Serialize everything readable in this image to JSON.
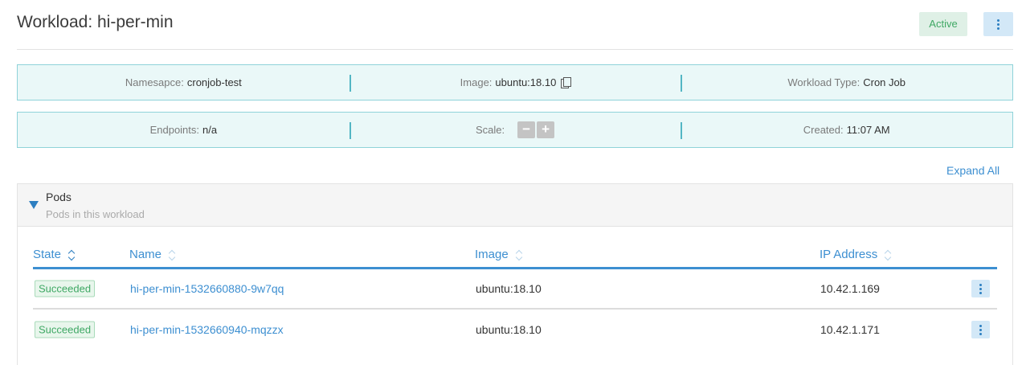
{
  "workload": {
    "title": "Workload: hi-per-min",
    "status": "Active"
  },
  "info_row1": {
    "namespace_label": "Namesapce:",
    "namespace_value": "cronjob-test",
    "image_label": "Image:",
    "image_value": "ubuntu:18.10",
    "type_label": "Workload Type:",
    "type_value": "Cron Job"
  },
  "info_row2": {
    "endpoints_label": "Endpoints:",
    "endpoints_value": "n/a",
    "scale_label": "Scale:",
    "scale_minus": "−",
    "scale_plus": "+",
    "created_label": "Created:",
    "created_value": "11:07 AM"
  },
  "expand_all": "Expand All",
  "pods": {
    "title": "Pods",
    "subtitle": "Pods in this workload",
    "columns": [
      "State",
      "Name",
      "Image",
      "IP Address"
    ],
    "rows": [
      {
        "state": "Succeeded",
        "name": "hi-per-min-1532660880-9w7qq",
        "image": "ubuntu:18.10",
        "ip": "10.42.1.169"
      },
      {
        "state": "Succeeded",
        "name": "hi-per-min-1532660940-mqzzx",
        "image": "ubuntu:18.10",
        "ip": "10.42.1.171"
      }
    ]
  },
  "colors": {
    "accent": "#3d8fd1",
    "success": "#3fa864",
    "info_bg": "#eaf8f8",
    "info_border": "#8fd3d9"
  },
  "icons": [
    "kebab-menu-icon",
    "copy-icon",
    "minus-icon",
    "plus-icon",
    "triangle-down-icon",
    "sort-icon"
  ]
}
